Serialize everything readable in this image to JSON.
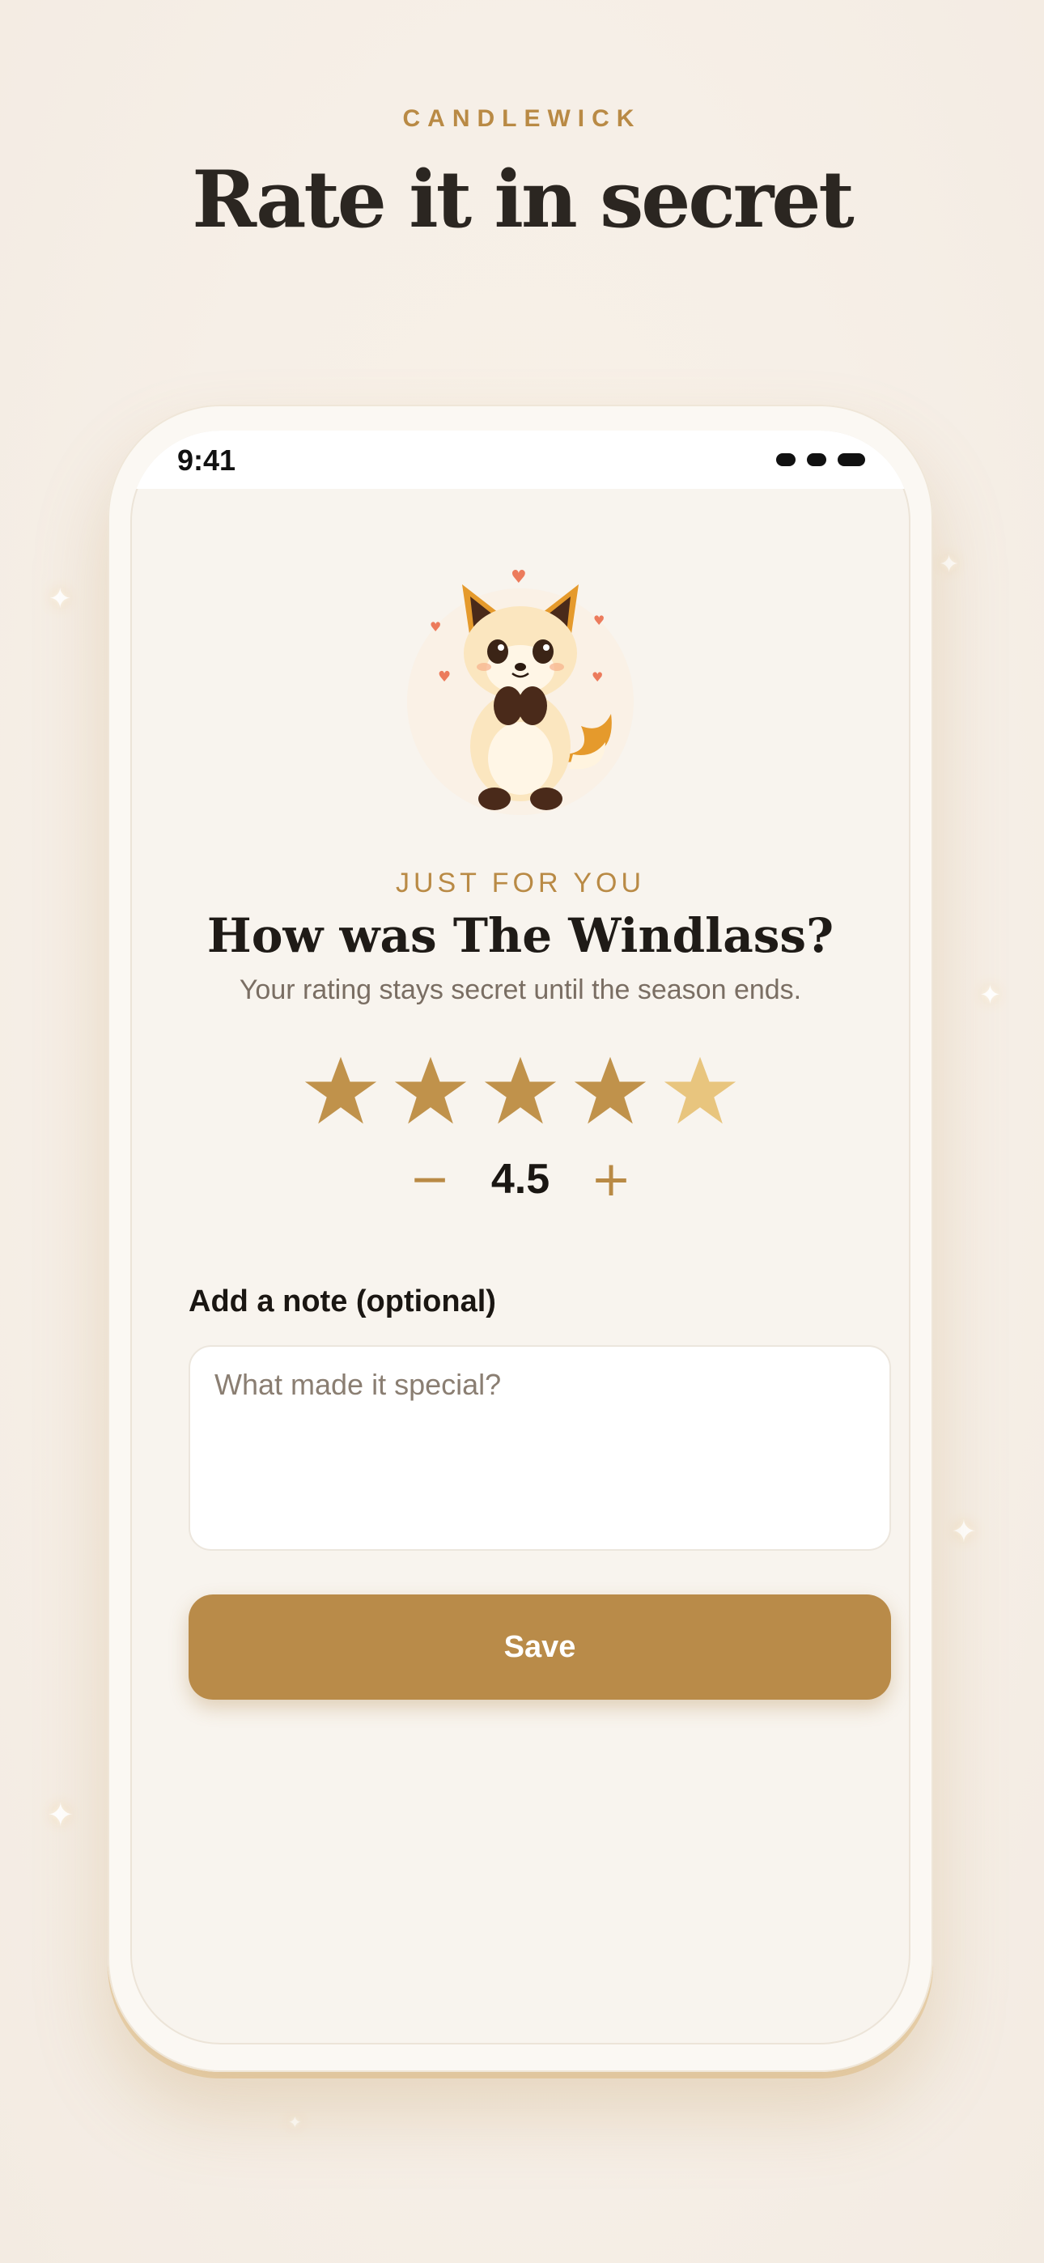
{
  "brand": "CANDLEWICK",
  "hero_title": "Rate it in secret",
  "status_bar": {
    "time": "9:41"
  },
  "card": {
    "eyebrow": "JUST FOR YOU",
    "question": "How was The Windlass?",
    "subtitle": "Your rating stays secret until the season ends."
  },
  "rating": {
    "value": "4.5",
    "max": 5,
    "stars_filled": 4.5,
    "minus_symbol": "−",
    "plus_symbol": "+"
  },
  "note": {
    "label": "Add a note (optional)",
    "placeholder": "What made it special?",
    "value": ""
  },
  "save_button": {
    "label": "Save"
  },
  "colors": {
    "accent": "#b98a45",
    "star_full": "#c0924b",
    "star_half": "#e8c57e",
    "button": "#b98b49",
    "heading": "#1f1b17"
  },
  "icons": [
    "fox-mascot-illustration",
    "star-icon",
    "minus-icon",
    "plus-icon"
  ]
}
